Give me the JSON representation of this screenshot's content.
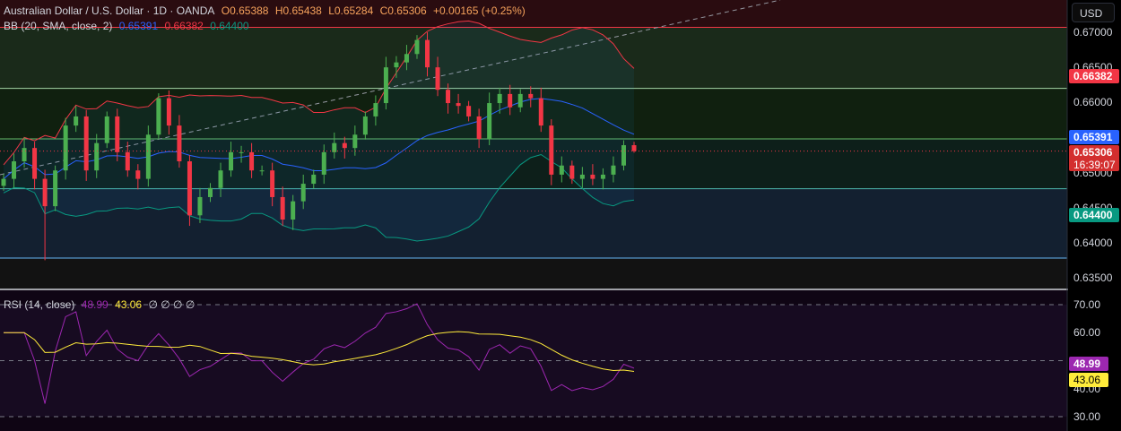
{
  "header": {
    "symbol": "Australian Dollar / U.S. Dollar · 1D · OANDA",
    "open": "O0.65388",
    "high": "H0.65438",
    "low": "L0.65284",
    "close": "C0.65306",
    "change": "+0.00165 (+0.25%)"
  },
  "bb_legend": {
    "label": "BB (20, SMA, close, 2)",
    "basis": "0.65391",
    "upper": "0.66382",
    "lower": "0.64400"
  },
  "rsi_legend": {
    "label": "RSI (14, close)",
    "rsi": "48.99",
    "ma": "43.06",
    "extras": "∅ ∅ ∅ ∅"
  },
  "axis": {
    "currency": "USD",
    "price_ticks": [
      "0.67000",
      "0.66500",
      "0.66000",
      "0.65500",
      "0.65000",
      "0.64500",
      "0.64000",
      "0.63500"
    ],
    "rsi_ticks": [
      "70.00",
      "60.00",
      "50.00",
      "40.00",
      "30.00"
    ],
    "tags": {
      "upper": "0.66382",
      "basis": "0.65391",
      "last": "0.65306",
      "countdown": "16:39:07",
      "lower": "0.64400",
      "rsi": "48.99",
      "rsi_ma": "43.06"
    }
  },
  "colors": {
    "up": "#4caf50",
    "down": "#f23645",
    "basis": "#2962ff",
    "upper": "#f23645",
    "lower": "#089981",
    "rsi": "#9c27b0",
    "rsi_ma": "#ffeb3b"
  },
  "chart_data": {
    "type": "candlestick",
    "title": "Australian Dollar / U.S. Dollar · 1D · OANDA",
    "ylim": [
      0.633,
      0.6715
    ],
    "rsi_ylim": [
      25,
      75
    ],
    "closes": [
      0.6491,
      0.6516,
      0.6535,
      0.6491,
      0.6452,
      0.6503,
      0.6567,
      0.658,
      0.6503,
      0.6542,
      0.658,
      0.6529,
      0.6503,
      0.6491,
      0.6554,
      0.6606,
      0.6567,
      0.6516,
      0.6439,
      0.6465,
      0.6478,
      0.6503,
      0.6529,
      0.6529,
      0.6503,
      0.6503,
      0.6465,
      0.6433,
      0.6459,
      0.6484,
      0.6497,
      0.6529,
      0.6542,
      0.6535,
      0.6554,
      0.658,
      0.6599,
      0.665,
      0.6657,
      0.6669,
      0.6689,
      0.665,
      0.6618,
      0.6599,
      0.6595,
      0.658,
      0.6548,
      0.6599,
      0.6612,
      0.6593,
      0.6612,
      0.6606,
      0.6567,
      0.6497,
      0.651,
      0.6491,
      0.6497,
      0.6491,
      0.6497,
      0.651,
      0.6539,
      0.65306
    ],
    "bb": {
      "length": 20,
      "mult": 2
    },
    "rsi": {
      "length": 14,
      "ma_length": 14,
      "levels": [
        70,
        50,
        30
      ]
    },
    "horizontal_levels": [
      0.6707,
      0.662,
      0.6548,
      0.6477,
      0.6378
    ]
  }
}
